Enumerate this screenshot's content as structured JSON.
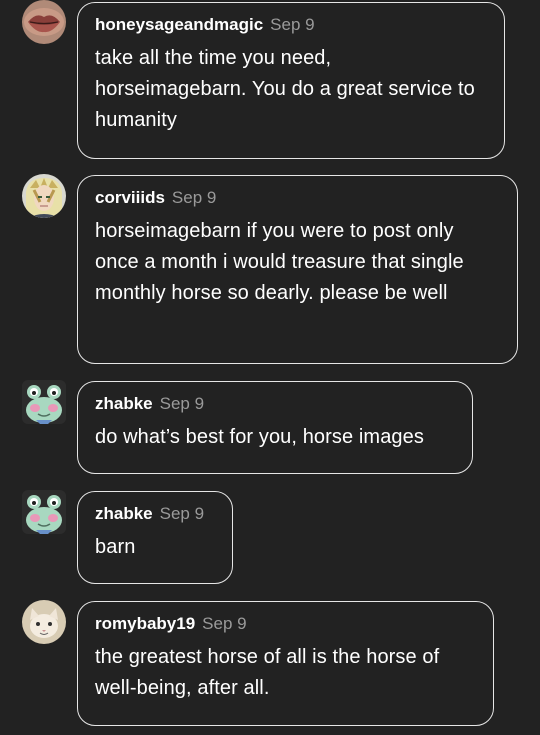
{
  "comments": [
    {
      "username": "honeysageandmagic",
      "date": "Sep 9",
      "avatar_icon": "lips-avatar",
      "text": "take all the time you need, horseimagebarn. You do a great service to humanity"
    },
    {
      "username": "corviiids",
      "date": "Sep 9",
      "avatar_icon": "anime-character-avatar",
      "text": "horseimagebarn if you were to post only once a month i would treasure that single monthly horse so dearly. please be well"
    },
    {
      "username": "zhabke",
      "date": "Sep 9",
      "avatar_icon": "frog-avatar",
      "text": "do what’s best for you, horse images"
    },
    {
      "username": "zhabke",
      "date": "Sep 9",
      "avatar_icon": "frog-avatar",
      "text": "barn"
    },
    {
      "username": "romybaby19",
      "date": "Sep 9",
      "avatar_icon": "cat-avatar",
      "text": "the greatest horse of all is the horse of well-being, after all."
    }
  ],
  "colors": {
    "background": "#222222",
    "bubble_border": "#e6e6e6",
    "username": "#ffffff",
    "date": "#9a9a9a"
  }
}
